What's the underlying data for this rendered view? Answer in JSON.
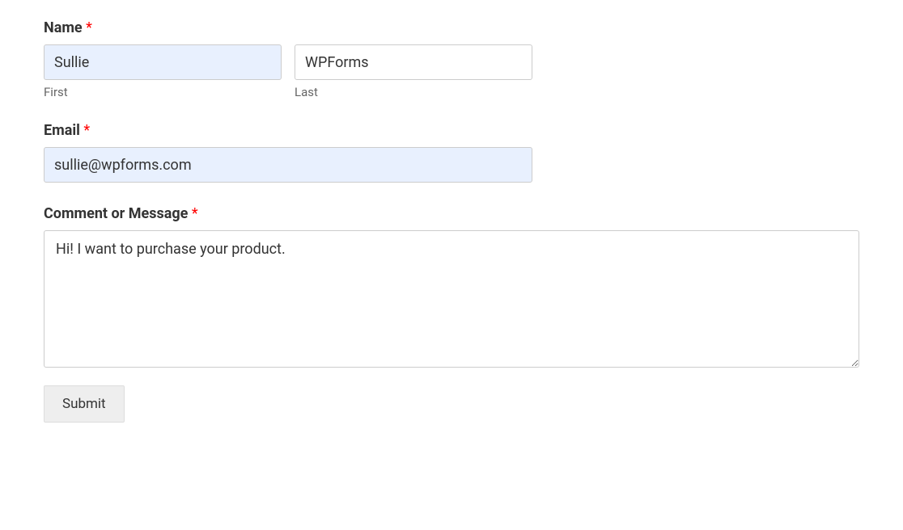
{
  "form": {
    "name": {
      "label": "Name",
      "required_marker": "*",
      "first_value": "Sullie",
      "first_sublabel": "First",
      "last_value": "WPForms",
      "last_sublabel": "Last"
    },
    "email": {
      "label": "Email",
      "required_marker": "*",
      "value": "sullie@wpforms.com"
    },
    "message": {
      "label": "Comment or Message",
      "required_marker": "*",
      "value": "Hi! I want to purchase your product."
    },
    "submit_label": "Submit"
  }
}
